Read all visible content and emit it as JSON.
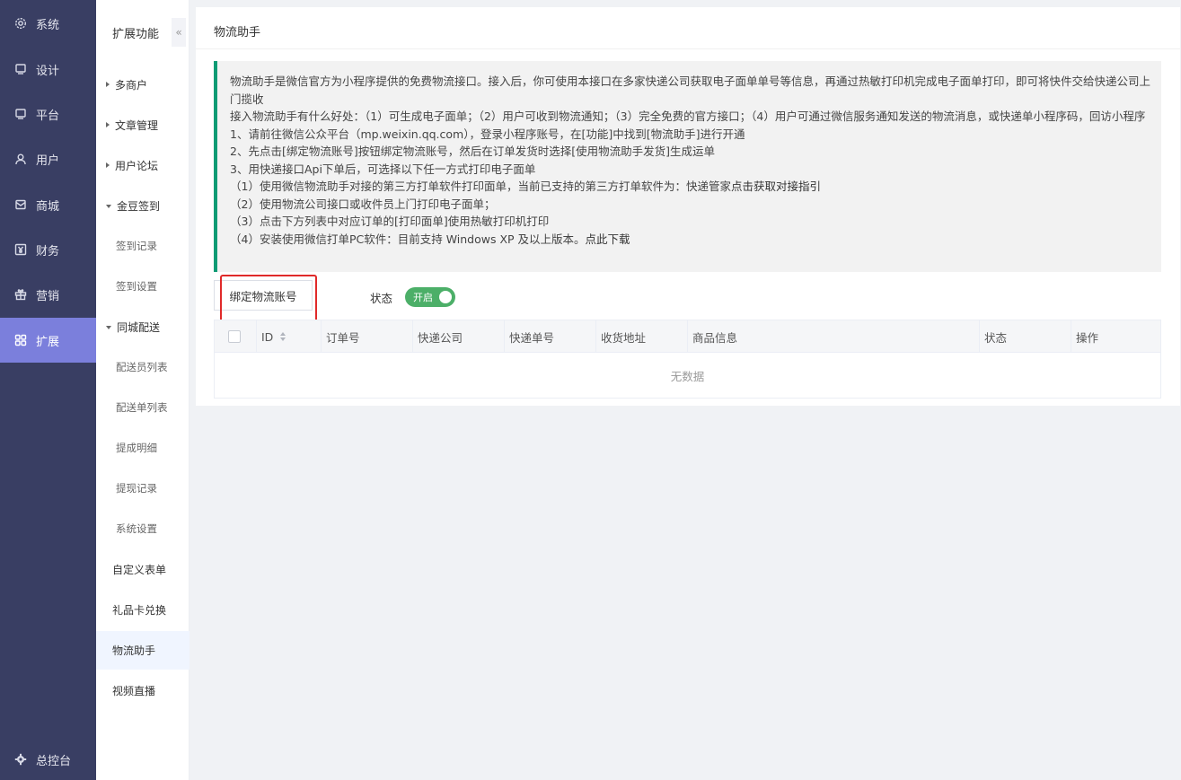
{
  "nav": {
    "items": [
      {
        "label": "系统",
        "icon": "gear-icon"
      },
      {
        "label": "设计",
        "icon": "monitor-icon"
      },
      {
        "label": "平台",
        "icon": "monitor-icon"
      },
      {
        "label": "用户",
        "icon": "user-icon"
      },
      {
        "label": "商城",
        "icon": "mail-icon"
      },
      {
        "label": "财务",
        "icon": "yen-icon"
      },
      {
        "label": "营销",
        "icon": "gift-icon"
      },
      {
        "label": "扩展",
        "icon": "grid-icon",
        "active": true
      }
    ],
    "bottom": {
      "label": "总控台",
      "icon": "gear-icon"
    }
  },
  "submenu": {
    "title": "扩展功能",
    "collapse_glyph": "«",
    "items": [
      {
        "label": "多商户",
        "type": "group",
        "caret": "right"
      },
      {
        "label": "文章管理",
        "type": "group",
        "caret": "right"
      },
      {
        "label": "用户论坛",
        "type": "group",
        "caret": "right"
      },
      {
        "label": "金豆签到",
        "type": "group",
        "caret": "down"
      },
      {
        "label": "签到记录",
        "type": "child"
      },
      {
        "label": "签到设置",
        "type": "child"
      },
      {
        "label": "同城配送",
        "type": "group",
        "caret": "down"
      },
      {
        "label": "配送员列表",
        "type": "child"
      },
      {
        "label": "配送单列表",
        "type": "child"
      },
      {
        "label": "提成明细",
        "type": "child"
      },
      {
        "label": "提现记录",
        "type": "child"
      },
      {
        "label": "系统设置",
        "type": "child"
      },
      {
        "label": "自定义表单",
        "type": "plain"
      },
      {
        "label": "礼品卡兑换",
        "type": "plain"
      },
      {
        "label": "物流助手",
        "type": "plain",
        "active": true
      },
      {
        "label": "视频直播",
        "type": "plain"
      }
    ]
  },
  "page": {
    "title": "物流助手",
    "notice": {
      "line1": "物流助手是微信官方为小程序提供的免费物流接口。接入后，你可使用本接口在多家快递公司获取电子面单单号等信息，再通过热敏打印机完成电子面单打印，即可将快件交给快递公司上门揽收",
      "line2": "接入物流助手有什么好处：（1）可生成电子面单；（2）用户可收到物流通知；（3）完全免费的官方接口；（4）用户可通过微信服务通知发送的物流消息，或快递单小程序码，回访小程序",
      "line3": "1、请前往微信公众平台（mp.weixin.qq.com），登录小程序账号，在[功能]中找到[物流助手]进行开通",
      "line4": "2、先点击[绑定物流账号]按钮绑定物流账号，然后在订单发货时选择[使用物流助手发货]生成运单",
      "line5": "3、用快递接口Api下单后，可选择以下任一方式打印电子面单",
      "line6_prefix": "（1）使用微信物流助手对接的第三方打单软件打印面单，当前已支持的第三方打单软件为：快递管家",
      "line6_link": "点击获取对接指引",
      "line7": "（2）使用物流公司接口或收件员上门打印电子面单；",
      "line8": "（3）点击下方列表中对应订单的[打印面单]使用热敏打印机打印",
      "line9_prefix": "（4）安装使用微信打单PC软件：目前支持 Windows XP 及以上版本。",
      "line9_link": "点此下载"
    },
    "bind_button": "绑定物流账号",
    "status_label": "状态",
    "toggle": {
      "label": "开启",
      "on": true,
      "color": "#4caf68"
    },
    "table": {
      "columns": [
        "ID",
        "订单号",
        "快递公司",
        "快递单号",
        "收货地址",
        "商品信息",
        "状态",
        "操作"
      ],
      "empty_text": "无数据"
    }
  },
  "colors": {
    "nav_bg": "#393e63",
    "nav_active": "#7b7fdc",
    "notice_accent": "#0d9b74",
    "highlight": "#e02a2a"
  }
}
